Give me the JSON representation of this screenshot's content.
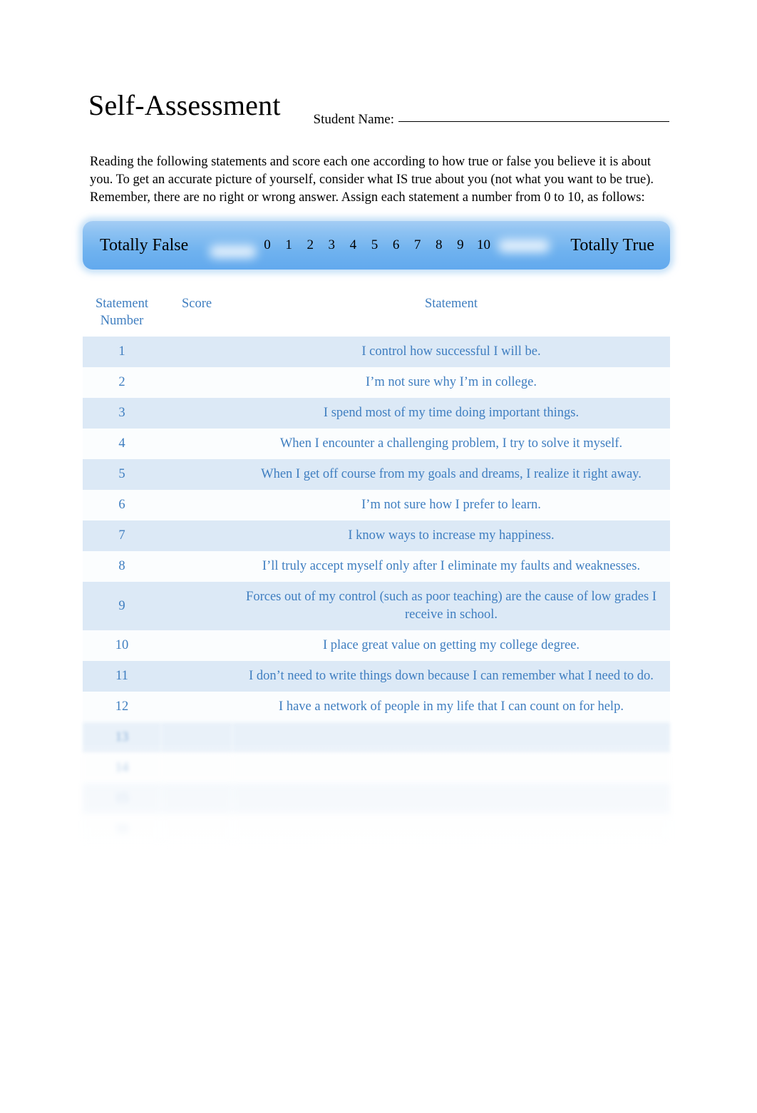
{
  "document": {
    "title": "Self-Assessment"
  },
  "student": {
    "label": "Student Name:"
  },
  "intro": {
    "text": "Reading the following statements and score each one according to how true or false you believe it is about you.   To get an accurate picture of yourself, consider what IS true about you (not what you want to be true).   Remember, there are no right or wrong answer.    Assign each statement a number from 0 to 10, as follows:"
  },
  "scale": {
    "left_label": "Totally False",
    "right_label": "Totally True",
    "numbers": [
      "0",
      "1",
      "2",
      "3",
      "4",
      "5",
      "6",
      "7",
      "8",
      "9",
      "10"
    ],
    "bar_color": "#6fb2ef",
    "bar_color_light": "#a5cdf4"
  },
  "table": {
    "headers": {
      "number": "Statement Number",
      "score": "Score",
      "statement": "Statement"
    },
    "text_color": "#3f7ec0",
    "row_shade_color": "#dce9f6",
    "rows": [
      {
        "number": "1",
        "score": "",
        "statement": "I control how successful I will be."
      },
      {
        "number": "2",
        "score": "",
        "statement": "I’m not sure why I’m in college."
      },
      {
        "number": "3",
        "score": "",
        "statement": "I spend most of my time doing important things."
      },
      {
        "number": "4",
        "score": "",
        "statement": "When I encounter a challenging problem, I try to solve it myself."
      },
      {
        "number": "5",
        "score": "",
        "statement": "When I get off course from my goals and dreams, I realize it right away."
      },
      {
        "number": "6",
        "score": "",
        "statement": "I’m not sure how I prefer to learn."
      },
      {
        "number": "7",
        "score": "",
        "statement": "I know ways to increase my happiness."
      },
      {
        "number": "8",
        "score": "",
        "statement": "I’ll truly accept myself only after I eliminate my faults and weaknesses."
      },
      {
        "number": "9",
        "score": "",
        "statement": "Forces out of my control (such as poor teaching) are the cause of low grades I receive in school."
      },
      {
        "number": "10",
        "score": "",
        "statement": "I place great value on getting my college degree."
      },
      {
        "number": "11",
        "score": "",
        "statement": "I don’t need to write things down because I can remember what I need to do."
      },
      {
        "number": "12",
        "score": "",
        "statement": "I have a network of people in my life that I can count on for help."
      },
      {
        "number": "13",
        "score": "",
        "statement": ""
      },
      {
        "number": "14",
        "score": "",
        "statement": ""
      },
      {
        "number": "15",
        "score": "",
        "statement": ""
      },
      {
        "number": "16",
        "score": "",
        "statement": ""
      }
    ]
  }
}
